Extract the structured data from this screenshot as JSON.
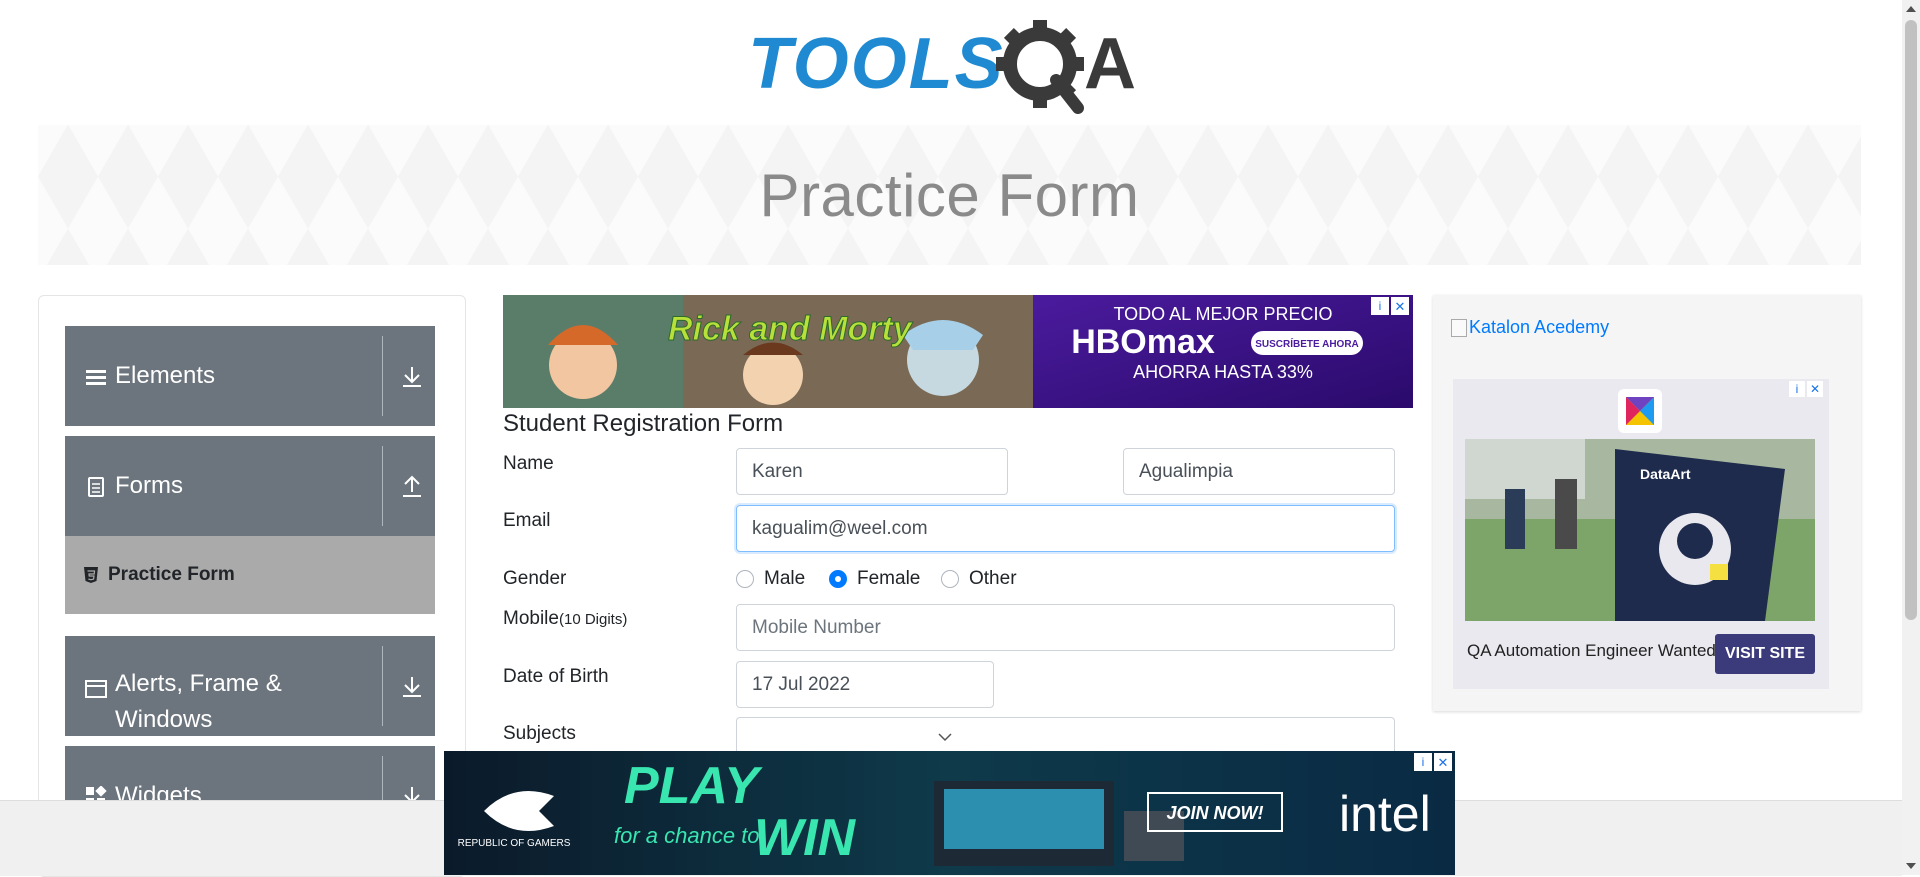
{
  "logo": {
    "text_tools": "TOOLS",
    "text_qa": "QA"
  },
  "banner": {
    "title": "Practice Form"
  },
  "sidebar": {
    "groups": [
      {
        "label": "Elements",
        "icon": "hamburger-icon",
        "arrow": "download-icon"
      },
      {
        "label": "Forms",
        "icon": "document-icon",
        "arrow": "upload-icon"
      },
      {
        "label": "Alerts, Frame &",
        "label2": "Windows",
        "icon": "window-icon",
        "arrow": "download-icon"
      },
      {
        "label": "Widgets",
        "icon": "widgets-icon",
        "arrow": "download-icon"
      }
    ],
    "active_item": {
      "label": "Practice Form",
      "icon": "html5-icon"
    }
  },
  "top_ad": {
    "headline": "TODO AL MEJOR PRECIO",
    "brand": "HBOmax",
    "cta": "SUSCRÍBETE AHORA",
    "offer": "AHORRA HASTA 33%",
    "show": "Rick and Morty"
  },
  "form": {
    "title": "Student Registration Form",
    "name_label": "Name",
    "first_name": "Karen",
    "last_name": "Agualimpia",
    "email_label": "Email",
    "email": "kagualim@weel.com",
    "gender_label": "Gender",
    "gender_options": [
      "Male",
      "Female",
      "Other"
    ],
    "gender_selected": "Female",
    "mobile_label": "Mobile",
    "mobile_hint": "(10 Digits)",
    "mobile_placeholder": "Mobile Number",
    "dob_label": "Date of Birth",
    "dob": "17 Jul 2022",
    "subjects_label": "Subjects"
  },
  "right_ad": {
    "katalon_link": "Katalon Acedemy",
    "dataart_logo": "DataArt",
    "text": "QA Automation Engineer Wanted",
    "button": "VISIT SITE"
  },
  "bottom_ad": {
    "brand_left": "REPUBLIC OF GAMERS",
    "headline1": "PLAY",
    "sub": "for a chance to",
    "headline2": "WIN",
    "cta": "JOIN NOW!",
    "brand_right": "intel"
  },
  "colors": {
    "brand_blue": "#1f8ad1",
    "brand_dark": "#3a3a3a",
    "sidebar_group": "#6c757d",
    "sidebar_active": "#aaaaaa",
    "link": "#007bff"
  }
}
